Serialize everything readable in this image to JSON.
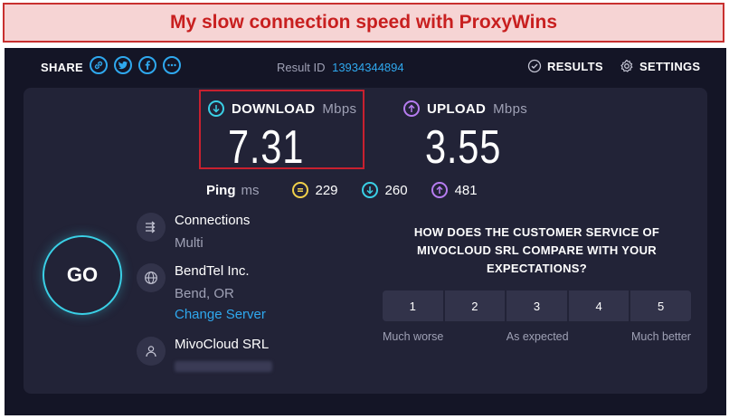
{
  "banner": {
    "title": "My slow connection speed with ProxyWins"
  },
  "topbar": {
    "share_label": "SHARE",
    "share_icons": [
      "link-icon",
      "twitter-icon",
      "facebook-icon",
      "more-icon"
    ],
    "result_id_label": "Result ID",
    "result_id_value": "13934344894",
    "results_label": "RESULTS",
    "settings_label": "SETTINGS"
  },
  "download": {
    "label": "DOWNLOAD",
    "unit": "Mbps",
    "value": "7.31",
    "color": "#3ad0e6"
  },
  "upload": {
    "label": "UPLOAD",
    "unit": "Mbps",
    "value": "3.55",
    "color": "#b67cf0"
  },
  "ping": {
    "label": "Ping",
    "unit": "ms",
    "idle": "229",
    "download": "260",
    "upload": "481",
    "idle_color": "#f0d04a"
  },
  "go_button": {
    "label": "GO"
  },
  "connections": {
    "title": "Connections",
    "value": "Multi"
  },
  "server": {
    "name": "BendTel Inc.",
    "location": "Bend, OR",
    "change_link": "Change Server"
  },
  "provider": {
    "name": "MivoCloud SRL"
  },
  "survey": {
    "question": "HOW DOES THE CUSTOMER SERVICE OF MIVOCLOUD SRL COMPARE WITH YOUR EXPECTATIONS?",
    "options": [
      "1",
      "2",
      "3",
      "4",
      "5"
    ],
    "low_label": "Much worse",
    "mid_label": "As expected",
    "high_label": "Much better"
  },
  "colors": {
    "accent": "#2fa8ee",
    "background": "#141526",
    "card": "#222337",
    "highlight": "#c8202f"
  }
}
